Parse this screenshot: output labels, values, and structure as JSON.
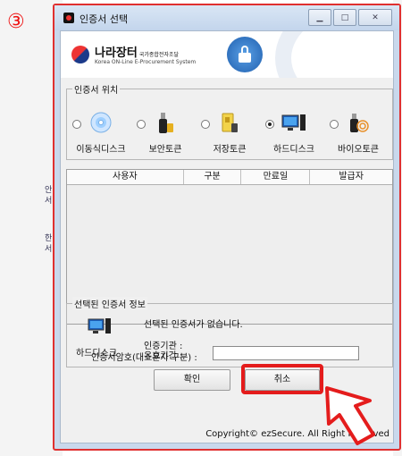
{
  "step_marker": "③",
  "window": {
    "title": "인증서 선택",
    "controls": [
      "minimize",
      "maximize",
      "close"
    ]
  },
  "header": {
    "logo_main": "나라장터",
    "logo_main_sub": "국가종합전자조달",
    "logo_sub": "Korea ON-Line E-Procurement System",
    "lock_icon": "padlock-icon"
  },
  "location": {
    "group_label": "인증서 위치",
    "items": [
      {
        "label": "이동식디스크",
        "icon": "cd-disc-icon",
        "selected": false
      },
      {
        "label": "보안토큰",
        "icon": "security-token-icon",
        "selected": false
      },
      {
        "label": "저장토큰",
        "icon": "storage-token-icon",
        "selected": false
      },
      {
        "label": "하드디스크",
        "icon": "monitor-pc-icon",
        "selected": true
      },
      {
        "label": "바이오토큰",
        "icon": "fingerprint-token-icon",
        "selected": false
      }
    ]
  },
  "table": {
    "columns": [
      "사용자",
      "구분",
      "만료일",
      "발급자"
    ],
    "rows": []
  },
  "info": {
    "group_label": "선택된 인증서 정보",
    "device_label": "하드디스크",
    "message": "선택된 인증서가 없습니다.",
    "issuer_label": "인증기관 :",
    "validity_label": "유효기간 :"
  },
  "password": {
    "label": "인증서암호(대소문자 구분) :",
    "value": ""
  },
  "buttons": {
    "confirm": "확인",
    "cancel": "취소"
  },
  "footer": {
    "copyright": "Copyright© ezSecure. All Right Reserved"
  },
  "background_fragments": [
    "안",
    "서",
    "한",
    "서"
  ],
  "colors": {
    "highlight": "#e41c1c",
    "titlebar": "#c9d8ec"
  }
}
